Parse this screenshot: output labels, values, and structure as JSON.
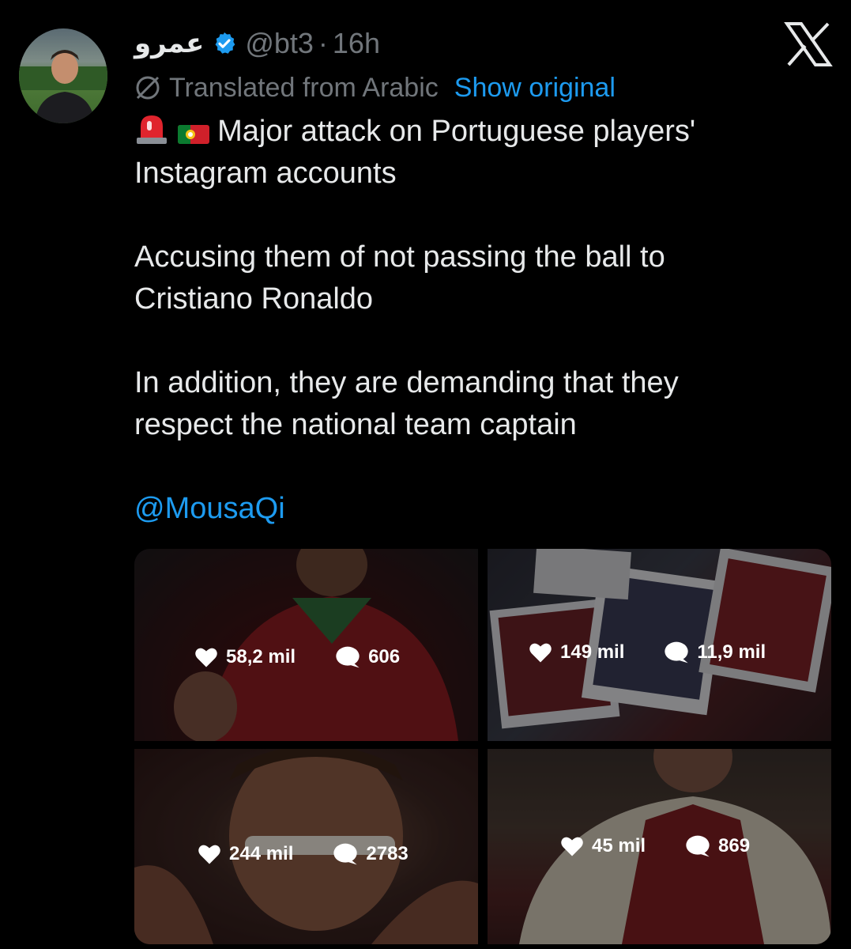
{
  "tweet": {
    "display_name": "عمرو",
    "handle": "@bt3",
    "separator": "·",
    "time": "16h",
    "translated_label": "Translated from Arabic",
    "show_original": "Show original",
    "paragraph1_line1": "Major attack on Portuguese players'",
    "paragraph1_line2": "Instagram accounts",
    "paragraph2_line1": "Accusing them of not passing the ball to",
    "paragraph2_line2": "Cristiano Ronaldo",
    "paragraph3_line1": "In addition, they are demanding that they",
    "paragraph3_line2": "respect the national team captain",
    "mention": "@MousaQi",
    "emojis": [
      "rotating-light-emoji",
      "portugal-flag-emoji"
    ]
  },
  "media": [
    {
      "likes": "58,2 mil",
      "comments": "606"
    },
    {
      "likes": "149 mil",
      "comments": "11,9 mil"
    },
    {
      "likes": "244 mil",
      "comments": "2783"
    },
    {
      "likes": "45 mil",
      "comments": "869"
    }
  ],
  "colors": {
    "background": "#000000",
    "text": "#e7e9ea",
    "muted": "#71767b",
    "link": "#1d9bf0",
    "verified": "#1d9bf0"
  }
}
